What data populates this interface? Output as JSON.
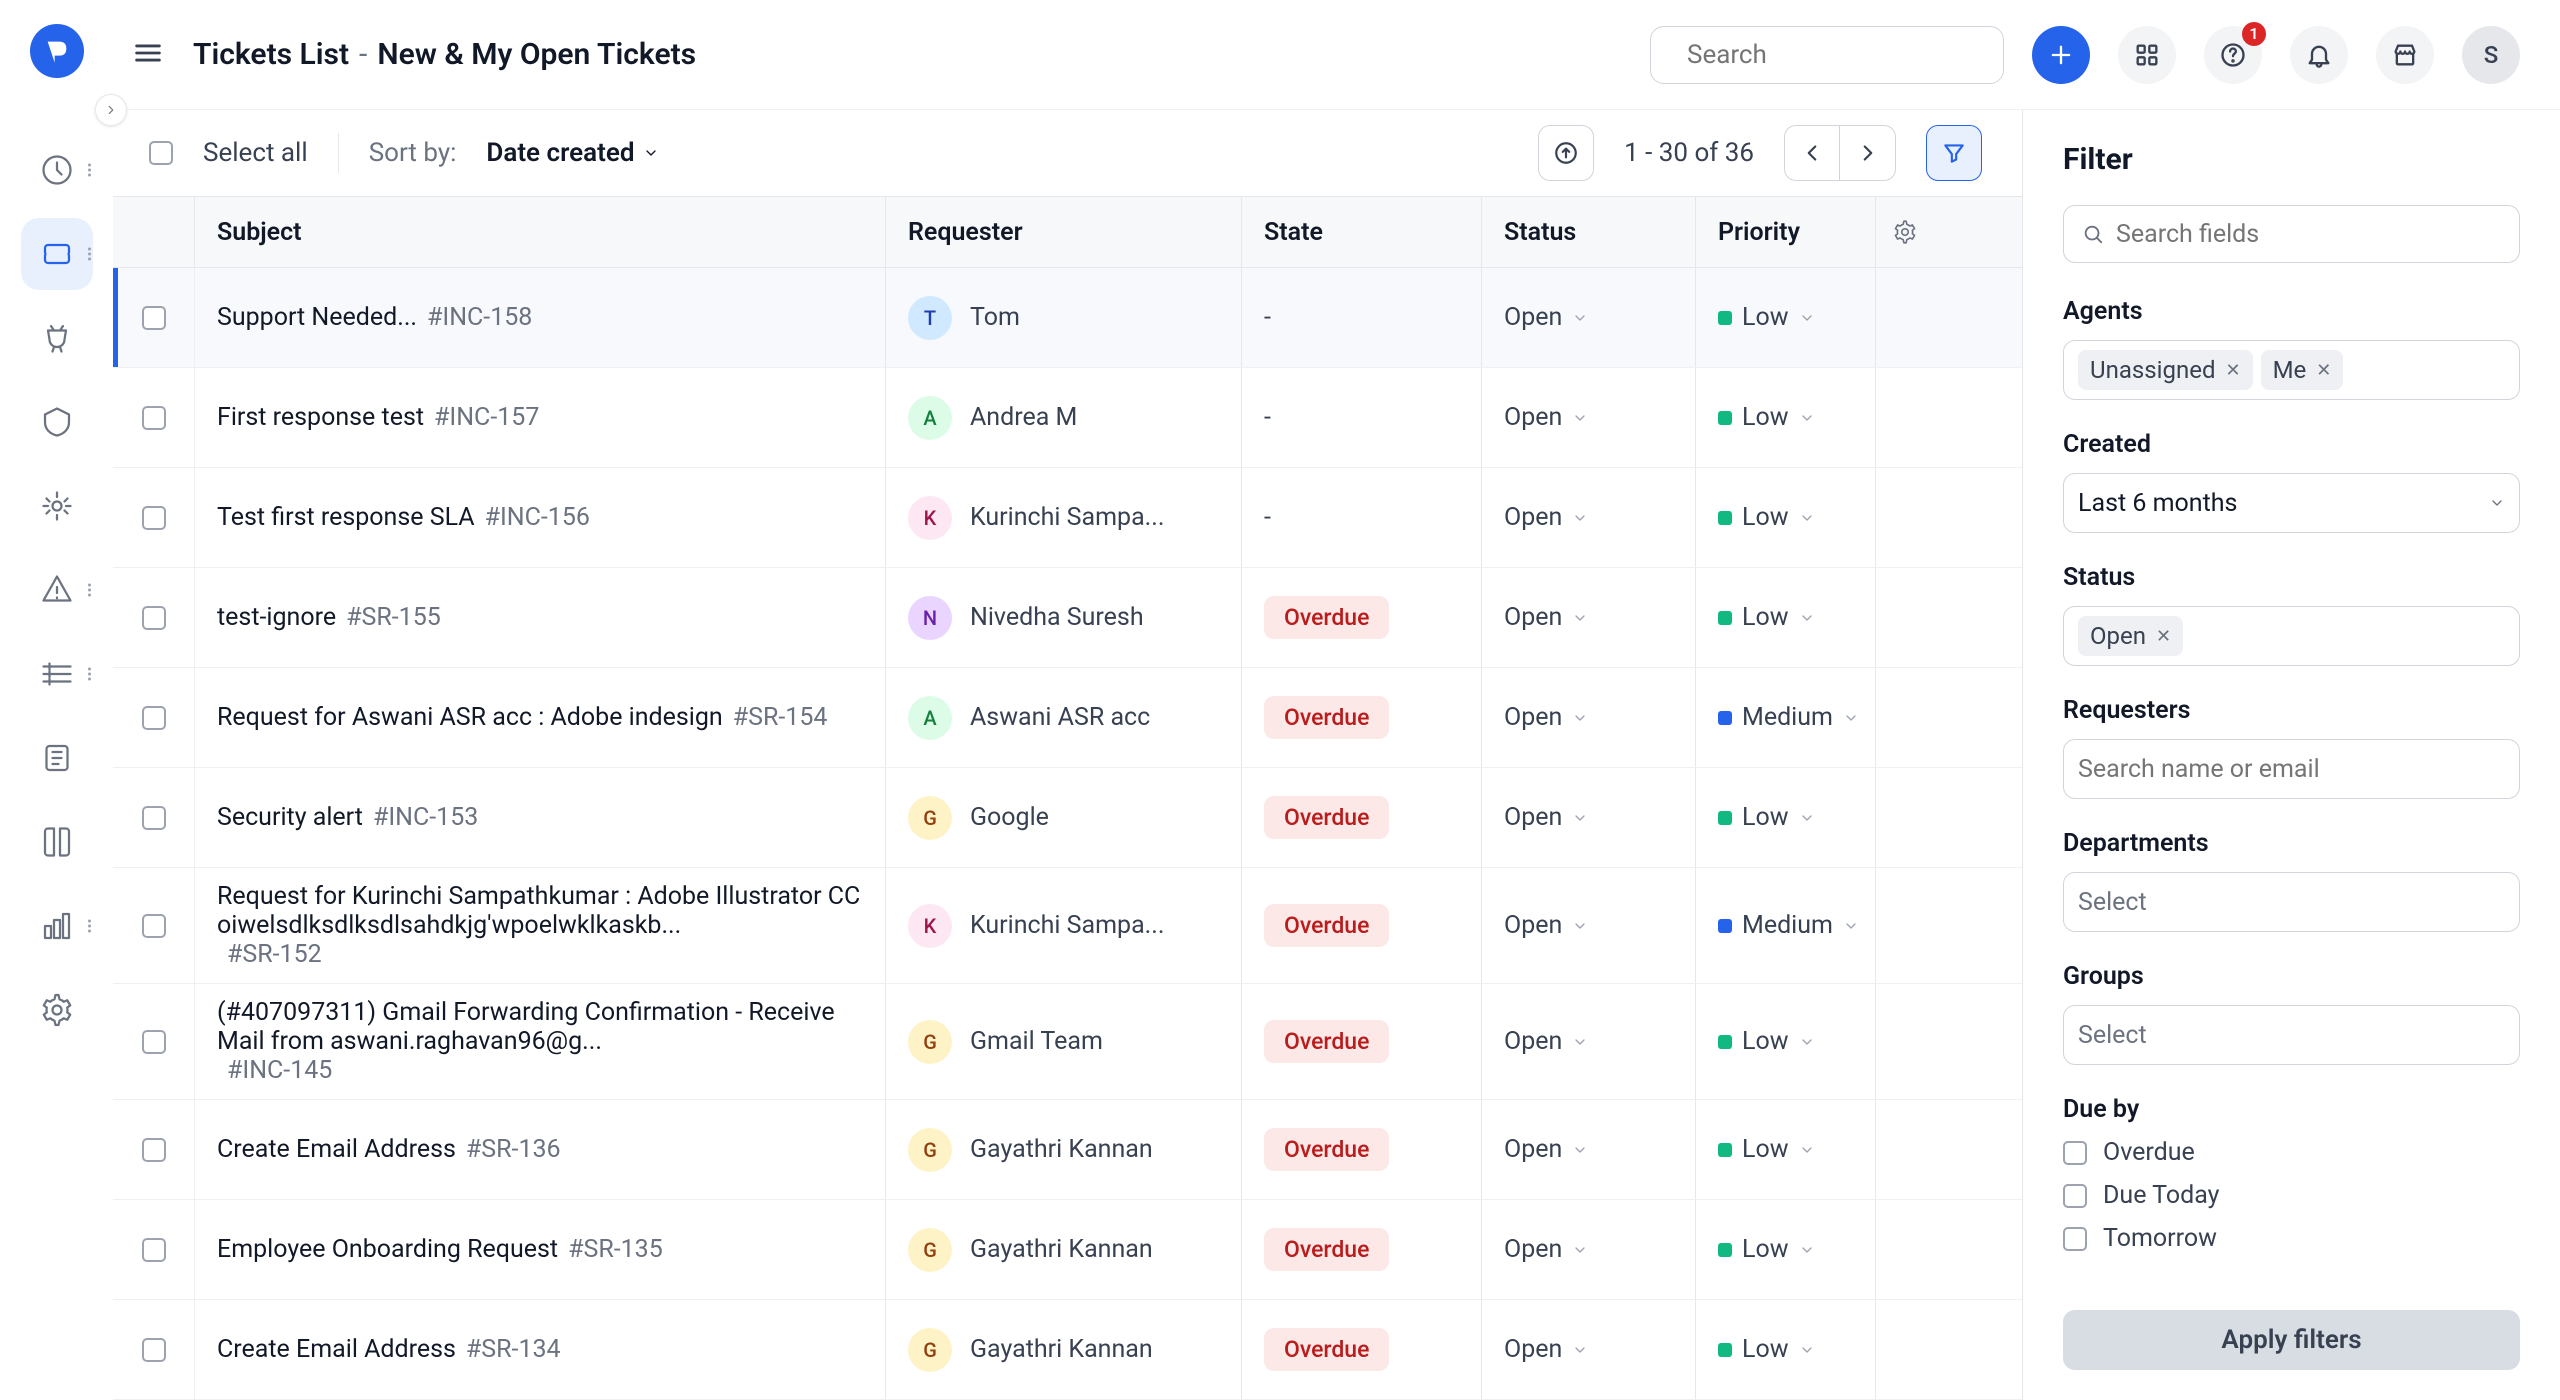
{
  "header": {
    "breadcrumb_root": "Tickets List",
    "breadcrumb_view": "New & My Open Tickets",
    "search_placeholder": "Search",
    "notification_count": "1",
    "avatar_initial": "S"
  },
  "toolbar": {
    "select_all": "Select all",
    "sort_label": "Sort by:",
    "sort_value": "Date created",
    "pagination": "1 - 30 of 36"
  },
  "columns": {
    "subject": "Subject",
    "requester": "Requester",
    "state": "State",
    "status": "Status",
    "priority": "Priority"
  },
  "status_labels": {
    "open": "Open"
  },
  "priority_labels": {
    "low": "Low",
    "medium": "Medium"
  },
  "state_labels": {
    "dash": "-",
    "overdue": "Overdue"
  },
  "rows": [
    {
      "subject": "Support Needed...",
      "ticket": "#INC-158",
      "requester": "Tom",
      "initial": "T",
      "avatar_bg": "#d1e9ff",
      "avatar_fg": "#1e40af",
      "state": "dash",
      "status": "open",
      "priority": "low",
      "hover": true
    },
    {
      "subject": "First response test",
      "ticket": "#INC-157",
      "requester": "Andrea M",
      "initial": "A",
      "avatar_bg": "#dcfce7",
      "avatar_fg": "#15803d",
      "state": "dash",
      "status": "open",
      "priority": "low"
    },
    {
      "subject": "Test first response SLA",
      "ticket": "#INC-156",
      "requester": "Kurinchi Sampa...",
      "initial": "K",
      "avatar_bg": "#fce7f3",
      "avatar_fg": "#9d174d",
      "state": "dash",
      "status": "open",
      "priority": "low"
    },
    {
      "subject": "test-ignore",
      "ticket": "#SR-155",
      "requester": "Nivedha Suresh",
      "initial": "N",
      "avatar_bg": "#e9d5ff",
      "avatar_fg": "#6b21a8",
      "state": "overdue",
      "status": "open",
      "priority": "low"
    },
    {
      "subject": "Request for Aswani ASR acc : Adobe indesign",
      "ticket": "#SR-154",
      "requester": "Aswani ASR acc",
      "initial": "A",
      "avatar_bg": "#dcfce7",
      "avatar_fg": "#15803d",
      "state": "overdue",
      "status": "open",
      "priority": "medium"
    },
    {
      "subject": "Security alert",
      "ticket": "#INC-153",
      "requester": "Google",
      "initial": "G",
      "avatar_bg": "#fef3c7",
      "avatar_fg": "#92400e",
      "state": "overdue",
      "status": "open",
      "priority": "low"
    },
    {
      "subject": "Request for Kurinchi Sampathkumar : Adobe Illustrator CC oiwelsdlksdlksdlsahdkjg'wpoelwklkaskb...",
      "ticket": "#SR-152",
      "requester": "Kurinchi Sampa...",
      "initial": "K",
      "avatar_bg": "#fce7f3",
      "avatar_fg": "#9d174d",
      "state": "overdue",
      "status": "open",
      "priority": "medium",
      "tall": true
    },
    {
      "subject": "(#407097311) Gmail Forwarding Confirmation - Receive Mail from aswani.raghavan96@g...",
      "ticket": "#INC-145",
      "requester": "Gmail Team",
      "initial": "G",
      "avatar_bg": "#fef3c7",
      "avatar_fg": "#92400e",
      "state": "overdue",
      "status": "open",
      "priority": "low",
      "tall": true
    },
    {
      "subject": "Create Email Address",
      "ticket": "#SR-136",
      "requester": "Gayathri Kannan",
      "initial": "G",
      "avatar_bg": "#fef3c7",
      "avatar_fg": "#92400e",
      "state": "overdue",
      "status": "open",
      "priority": "low"
    },
    {
      "subject": "Employee Onboarding Request",
      "ticket": "#SR-135",
      "requester": "Gayathri Kannan",
      "initial": "G",
      "avatar_bg": "#fef3c7",
      "avatar_fg": "#92400e",
      "state": "overdue",
      "status": "open",
      "priority": "low"
    },
    {
      "subject": "Create Email Address",
      "ticket": "#SR-134",
      "requester": "Gayathri Kannan",
      "initial": "G",
      "avatar_bg": "#fef3c7",
      "avatar_fg": "#92400e",
      "state": "overdue",
      "status": "open",
      "priority": "low"
    }
  ],
  "filter": {
    "title": "Filter",
    "search_placeholder": "Search fields",
    "agents_label": "Agents",
    "agents_chips": [
      "Unassigned",
      "Me"
    ],
    "created_label": "Created",
    "created_value": "Last 6 months",
    "status_label": "Status",
    "status_chips": [
      "Open"
    ],
    "requesters_label": "Requesters",
    "requesters_placeholder": "Search name or email",
    "departments_label": "Departments",
    "departments_placeholder": "Select",
    "groups_label": "Groups",
    "groups_placeholder": "Select",
    "dueby_label": "Due by",
    "dueby_options": [
      "Overdue",
      "Due Today",
      "Tomorrow"
    ],
    "apply": "Apply filters"
  }
}
